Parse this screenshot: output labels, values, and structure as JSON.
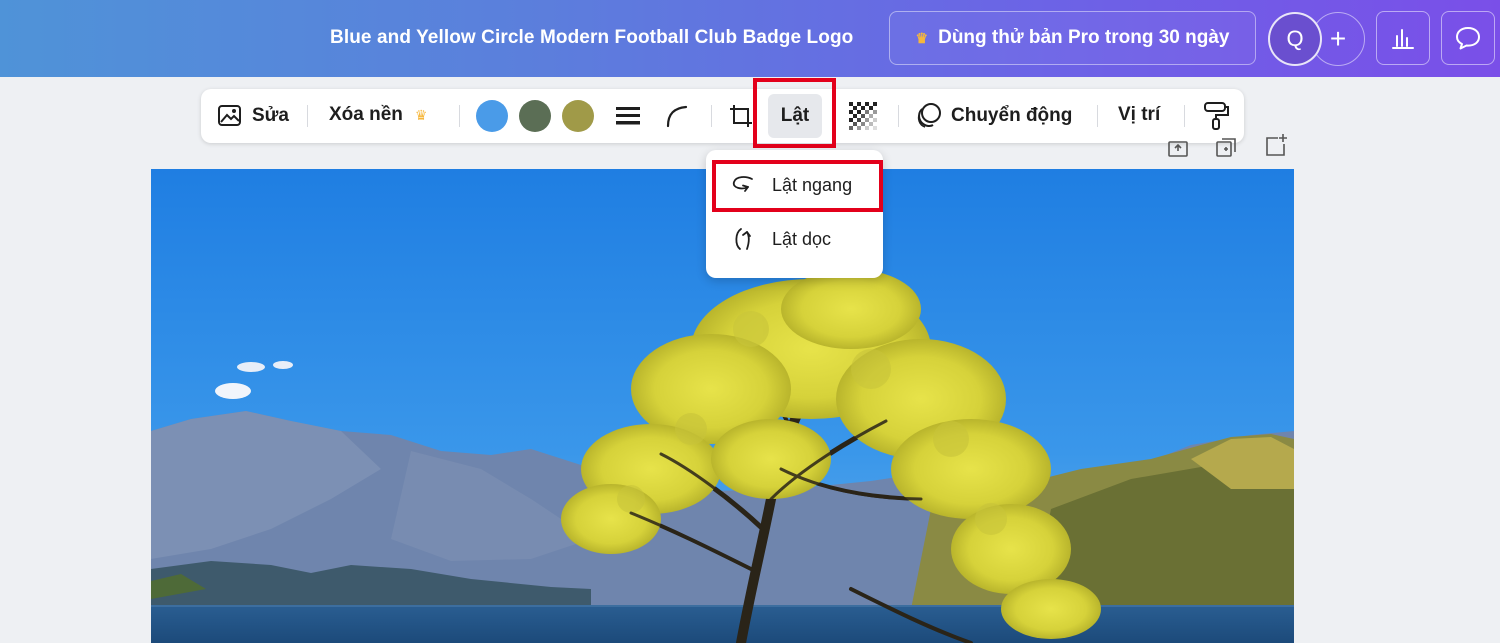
{
  "header": {
    "title": "Blue and Yellow Circle Modern Football Club Badge Logo",
    "pro_button": "Dùng thử bản Pro trong 30 ngày",
    "avatar_letter": "Q",
    "add_symbol": "+"
  },
  "toolbar": {
    "edit_label": "Sửa",
    "remove_bg_label": "Xóa nền",
    "flip_label": "Lật",
    "animate_label": "Chuyển động",
    "position_label": "Vị trí",
    "colors": [
      "#4a9be8",
      "#5b6e55",
      "#a09a48"
    ]
  },
  "flip_menu": {
    "items": [
      {
        "label": "Lật ngang",
        "icon": "flip-horizontal-icon"
      },
      {
        "label": "Lật dọc",
        "icon": "flip-vertical-icon"
      }
    ]
  },
  "colors": {
    "highlight": "#e3001b",
    "crown": "#f6b73c"
  }
}
